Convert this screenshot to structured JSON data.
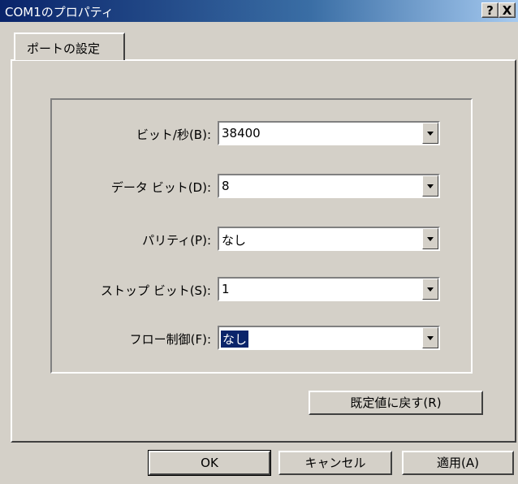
{
  "window": {
    "title": "COM1のプロパティ",
    "help_glyph": "?",
    "close_glyph": "X"
  },
  "tabs": [
    {
      "label": "ポートの設定"
    }
  ],
  "settings": [
    {
      "label": "ビット/秒(B):",
      "value": "38400"
    },
    {
      "label": "データ ビット(D):",
      "value": "8"
    },
    {
      "label": "パリティ(P):",
      "value": "なし"
    },
    {
      "label": "ストップ ビット(S):",
      "value": "1"
    },
    {
      "label": "フロー制御(F):",
      "value": "なし"
    }
  ],
  "restore_defaults_label": "既定値に戻す(R)",
  "footer": {
    "ok_label": "OK",
    "cancel_label": "キャンセル",
    "apply_label": "適用(A)"
  }
}
